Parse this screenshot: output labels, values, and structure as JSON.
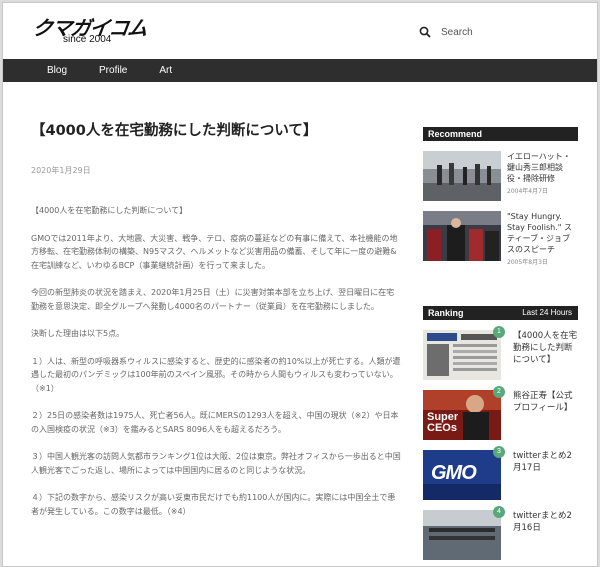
{
  "site": {
    "logo_text": "クマガイコム",
    "logo_sub": "since 2004"
  },
  "search": {
    "label": "Search"
  },
  "nav": {
    "items": [
      "Blog",
      "Profile",
      "Art"
    ]
  },
  "article": {
    "title": "【4000人を在宅勤務にした判断について】",
    "date": "2020年1月29日",
    "paragraphs": [
      "【4000人を在宅勤務にした判断について】",
      "GMOでは2011年より、大地震、大災害、戦争、テロ、疫病の蔓延などの有事に備えて、本社機能の地方移転、在宅勤務体制の構築、N95マスク、ヘルメットなど災害用品の備蓄、そして年に一度の避難&在宅訓練など、いわゆるBCP（事業継続計画）を行って来ました。",
      "今回の新型肺炎の状況を踏まえ、2020年1月25日（土）に災害対策本部を立ち上げ、翌日曜日に在宅勤務を意思決定、即全グループへ発動し4000名のパートナー（従業員）を在宅勤務にしました。",
      "決断した理由は以下5点。",
      "１）人は、新型の呼吸器系ウィルスに感染すると、歴史的に感染者の約10%以上が死亡する。人類が遭遇した最初のパンデミックは100年前のスペイン風邪。その時から人間もウィルスも変わっていない。（※1）",
      "２）25日の感染者数は1975人、死亡者56人。既にMERSの1293人を超え、中国の現状（※2）や日本の入国検疫の状況（※3）を鑑みるとSARS 8096人をも超えるだろう。",
      "３）中国人観光客の訪問人気都市ランキング1位は大阪、2位は東京。弊社オフィスから一歩出ると中国人観光客でごった返し、場所によっては中国国内に居るのと同じような状況。",
      "４）下記の数字から、感染リスクが高い妥東市民だけでも約1100人が国内に。実際には中国全土で患者が発生している。この数字は最低。（※4）"
    ]
  },
  "sidebar": {
    "recommend": {
      "heading": "Recommend",
      "items": [
        {
          "title": "イエローハット・鍵山秀三郎相談役・掃除研修",
          "date": "2004年4月7日"
        },
        {
          "title": "\"Stay Hungry. Stay Foolish.\" スティーブ・ジョブスのスピーチ",
          "date": "2005年8月3日"
        }
      ]
    },
    "ranking": {
      "heading": "Ranking",
      "subheading": "Last 24 Hours",
      "items": [
        {
          "rank": "1",
          "title": "【4000人を在宅勤務にした判断について】",
          "thumb_text": ""
        },
        {
          "rank": "2",
          "title": "熊谷正寿【公式プロフィール】",
          "thumb_text": "Super CEOs"
        },
        {
          "rank": "3",
          "title": "twitterまとめ2月17日",
          "thumb_text": "GMO"
        },
        {
          "rank": "4",
          "title": "twitterまとめ2月16日",
          "thumb_text": ""
        }
      ]
    }
  }
}
